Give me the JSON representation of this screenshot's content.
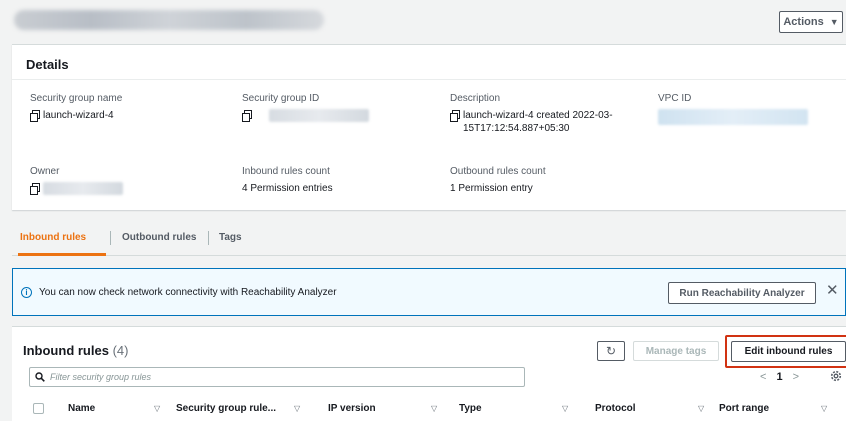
{
  "header": {
    "actions_label": "Actions"
  },
  "details": {
    "title": "Details",
    "fields": {
      "sg_name": {
        "label": "Security group name",
        "value": "launch-wizard-4"
      },
      "sg_id": {
        "label": "Security group ID"
      },
      "description": {
        "label": "Description",
        "value": "launch-wizard-4 created 2022-03-15T17:12:54.887+05:30"
      },
      "vpc_id": {
        "label": "VPC ID"
      },
      "owner": {
        "label": "Owner"
      },
      "inbound_count": {
        "label": "Inbound rules count",
        "value": "4 Permission entries"
      },
      "outbound_count": {
        "label": "Outbound rules count",
        "value": "1 Permission entry"
      }
    }
  },
  "tabs": [
    {
      "label": "Inbound rules",
      "active": true
    },
    {
      "label": "Outbound rules",
      "active": false
    },
    {
      "label": "Tags",
      "active": false
    }
  ],
  "alert": {
    "text": "You can now check network connectivity with Reachability Analyzer",
    "button_label": "Run Reachability Analyzer",
    "close_glyph": "✕"
  },
  "rules_panel": {
    "title": "Inbound rules",
    "count": "(4)",
    "refresh_glyph": "↻",
    "manage_tags_label": "Manage tags",
    "edit_label": "Edit inbound rules",
    "filter_placeholder": "Filter security group rules",
    "page": "1",
    "prev_glyph": "<",
    "next_glyph": ">"
  },
  "table": {
    "columns": [
      "Name",
      "Security group rule...",
      "IP version",
      "Type",
      "Protocol",
      "Port range"
    ]
  },
  "colors": {
    "accent": "#ec7211",
    "info": "#0073bb",
    "highlight": "#d13212"
  }
}
